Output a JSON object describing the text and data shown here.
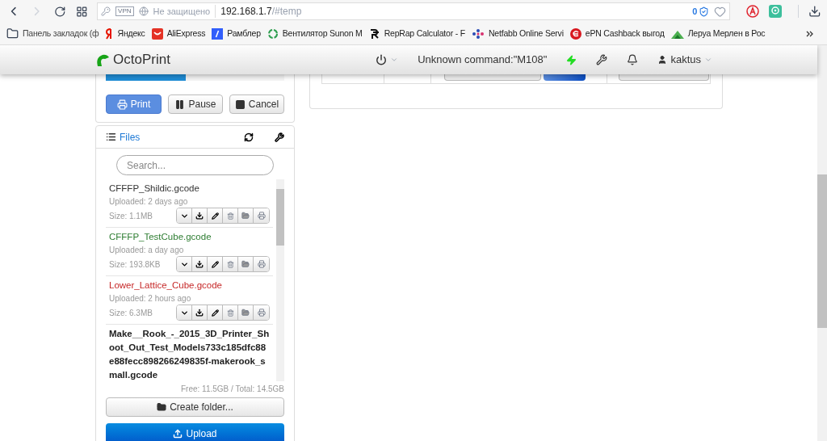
{
  "browser": {
    "vpn": "VPN",
    "security": "Не защищено",
    "url_host": "192.168.1.7",
    "url_path": "/#temp",
    "tracker_count": "0"
  },
  "bookmarks": [
    {
      "kind": "folder",
      "label": "Панель закладок (ф"
    },
    {
      "kind": "yandex",
      "label": "Яндекс"
    },
    {
      "kind": "ali",
      "label": "AliExpress"
    },
    {
      "kind": "rambler",
      "label": "Рамблер"
    },
    {
      "kind": "fan",
      "label": "Вентилятор Sunon M"
    },
    {
      "kind": "reprap",
      "label": "RepRap Calculator - F"
    },
    {
      "kind": "netfabb",
      "label": "Netfabb Online Servi"
    },
    {
      "kind": "epn",
      "label": "ePN Cashback выгод"
    },
    {
      "kind": "leroy",
      "label": "Леруа Мерлен в Рос"
    }
  ],
  "navbar": {
    "brand": "OctoPrint",
    "status": "Unknown command:\"M108\"",
    "user": "kaktus"
  },
  "job": {
    "progress": {
      "level": 0.45
    },
    "buttons": [
      {
        "kind": "print",
        "label": "Print"
      },
      {
        "kind": "pause",
        "label": "Pause"
      },
      {
        "kind": "cancel",
        "label": "Cancel"
      }
    ]
  },
  "files": {
    "title": "Files",
    "search": {
      "placeholder": "Search..."
    },
    "items": [
      {
        "name": "CFFFP_Shildic.gcode",
        "kind": "none",
        "uploaded": "Uploaded: 2 days ago",
        "size": "Size: 1.1MB"
      },
      {
        "name": "CFFFP_TestCube.gcode",
        "kind": "success",
        "uploaded": "Uploaded: a day ago",
        "size": "Size: 193.8KB"
      },
      {
        "name": "Lower_Lattice_Cube.gcode",
        "kind": "failed",
        "uploaded": "Uploaded: 2 hours ago",
        "size": "Size: 6.3MB"
      },
      {
        "name": "Make__Rook_-_2015_3D_Printer_Shoot_Out_Test_Models733c185dfc88e88fecc898266249835f-makerook_small.gcode",
        "kind": "selected"
      }
    ],
    "usage": "Free: 11.5GB / Total: 14.5GB",
    "create_folder": "Create folder...",
    "upload": "Upload"
  }
}
